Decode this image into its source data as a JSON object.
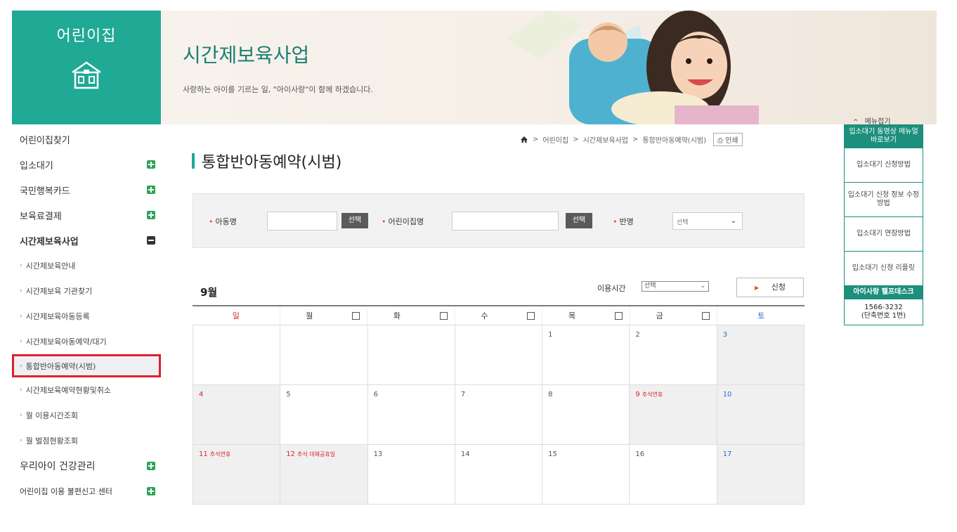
{
  "brand": {
    "title": "어린이집",
    "icon": "house-icon"
  },
  "banner": {
    "title": "시간제보육사업",
    "subtitle": "사랑하는 아이를 기르는 일, \"아이사랑\"이 함께 하겠습니다."
  },
  "sidenav": {
    "items": [
      {
        "label": "어린이집찾기",
        "toggle": "none"
      },
      {
        "label": "입소대기",
        "toggle": "plus"
      },
      {
        "label": "국민행복카드",
        "toggle": "plus"
      },
      {
        "label": "보육료결제",
        "toggle": "plus"
      },
      {
        "label": "시간제보육사업",
        "toggle": "minus"
      }
    ],
    "sub_items": [
      "시간제보육안내",
      "시간제보육 기관찾기",
      "시간제보육아동등록",
      "시간제보육아동예약/대기",
      "통합반아동예약(시범)",
      "시간제보육예약현황및취소",
      "월 이용시간조회",
      "월 벌점현황조회"
    ],
    "bottom_items": [
      {
        "label": "우리아이 건강관리",
        "toggle": "plus"
      },
      {
        "label": "어린이집 이용 불편신고 센터",
        "toggle": "plus"
      }
    ]
  },
  "breadcrumb": {
    "items": [
      "어린이집",
      "시간제보육사업",
      "통합반아동예약(시범)"
    ],
    "separator": ">",
    "print_label": "인쇄"
  },
  "page_title": "통합반아동예약(시범)",
  "search": {
    "child_label": "아동명",
    "select_btn": "선택",
    "daycare_label": "어린이집명",
    "class_label": "반명",
    "class_select_value": "선택"
  },
  "calendar": {
    "month": "9월",
    "time_label": "이용시간",
    "time_select_value": "선택",
    "apply_label": "신청",
    "weekdays": [
      {
        "label": "일",
        "checkbox": false,
        "tone": "sun"
      },
      {
        "label": "월",
        "checkbox": true,
        "tone": ""
      },
      {
        "label": "화",
        "checkbox": true,
        "tone": ""
      },
      {
        "label": "수",
        "checkbox": true,
        "tone": ""
      },
      {
        "label": "목",
        "checkbox": true,
        "tone": ""
      },
      {
        "label": "금",
        "checkbox": true,
        "tone": ""
      },
      {
        "label": "토",
        "checkbox": false,
        "tone": "sat"
      }
    ],
    "weeks": [
      [
        {
          "day": "",
          "note": "",
          "tone": "",
          "gray": false
        },
        {
          "day": "",
          "note": "",
          "tone": "",
          "gray": false
        },
        {
          "day": "",
          "note": "",
          "tone": "",
          "gray": false
        },
        {
          "day": "",
          "note": "",
          "tone": "",
          "gray": false
        },
        {
          "day": "1",
          "note": "",
          "tone": "",
          "gray": false
        },
        {
          "day": "2",
          "note": "",
          "tone": "",
          "gray": false
        },
        {
          "day": "3",
          "note": "",
          "tone": "blue",
          "gray": true
        }
      ],
      [
        {
          "day": "4",
          "note": "",
          "tone": "red",
          "gray": true
        },
        {
          "day": "5",
          "note": "",
          "tone": "",
          "gray": false
        },
        {
          "day": "6",
          "note": "",
          "tone": "",
          "gray": false
        },
        {
          "day": "7",
          "note": "",
          "tone": "",
          "gray": false
        },
        {
          "day": "8",
          "note": "",
          "tone": "",
          "gray": false
        },
        {
          "day": "9",
          "note": "추석연휴",
          "tone": "red",
          "gray": true
        },
        {
          "day": "10",
          "note": "",
          "tone": "blue",
          "gray": true
        }
      ],
      [
        {
          "day": "11",
          "note": "추석연휴",
          "tone": "red",
          "gray": true
        },
        {
          "day": "12",
          "note": "추석 대체공휴일",
          "tone": "red",
          "gray": true
        },
        {
          "day": "13",
          "note": "",
          "tone": "",
          "gray": false
        },
        {
          "day": "14",
          "note": "",
          "tone": "",
          "gray": false
        },
        {
          "day": "15",
          "note": "",
          "tone": "",
          "gray": false
        },
        {
          "day": "16",
          "note": "",
          "tone": "",
          "gray": false
        },
        {
          "day": "17",
          "note": "",
          "tone": "blue",
          "gray": true
        }
      ]
    ]
  },
  "quick_menu": {
    "toggle_label": "메뉴접기",
    "head": "입소대기 동영상 메뉴얼 바로보기",
    "items": [
      "입소대기 신청방법",
      "입소대기 신청 정보 수정방법",
      "입소대기 연장방법",
      "입소대기 신청 리플릿"
    ],
    "help_title": "아이사랑 헬프데스크",
    "phone": "1566-3232",
    "phone_note": "(단축번호 1번)"
  },
  "colors": {
    "brand_green": "#20a995",
    "quick_green": "#1d8f7d",
    "highlight_red": "#e0202c",
    "saturday_blue": "#1e6fd0"
  }
}
